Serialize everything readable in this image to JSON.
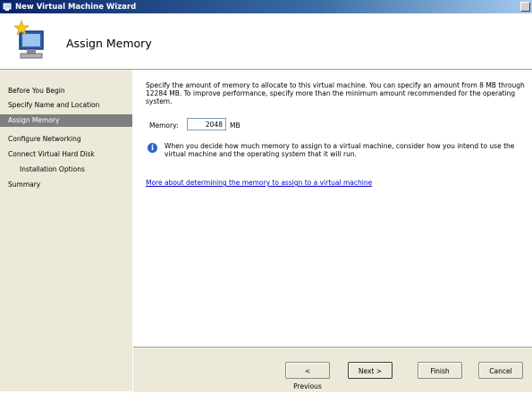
{
  "window": {
    "title": "New Virtual Machine Wizard"
  },
  "header": {
    "title": "Assign Memory"
  },
  "sidebar": {
    "items": [
      {
        "label": "Before You Begin"
      },
      {
        "label": "Specify Name and Location"
      },
      {
        "label": "Assign Memory"
      },
      {
        "label": "Configure Networking"
      },
      {
        "label": "Connect Virtual Hard Disk"
      },
      {
        "label": "Installation Options"
      },
      {
        "label": "Summary"
      }
    ],
    "active_item": "Assign Memory"
  },
  "main": {
    "description": "Specify the amount of memory to allocate to this virtual machine. You can specify an amount from 8 MB through 12284 MB. To improve performance, specify more than the minimum amount recommended for the operating system.",
    "memory_label": "Memory:",
    "memory_value": "2048",
    "memory_unit": "MB",
    "info_text": "When you decide how much memory to assign to a virtual machine, consider how you intend to use the virtual machine and the operating system that it will run.",
    "more_link": "More about determining the memory to assign to a virtual machine"
  },
  "footer": {
    "previous_label": "< Previous",
    "next_label": "Next >",
    "finish_label": "Finish",
    "cancel_label": "Cancel"
  },
  "icons": {
    "app": "wizard-app-icon",
    "header": "computer-monitor-star-icon",
    "info": "info-icon",
    "close": "close-icon"
  }
}
